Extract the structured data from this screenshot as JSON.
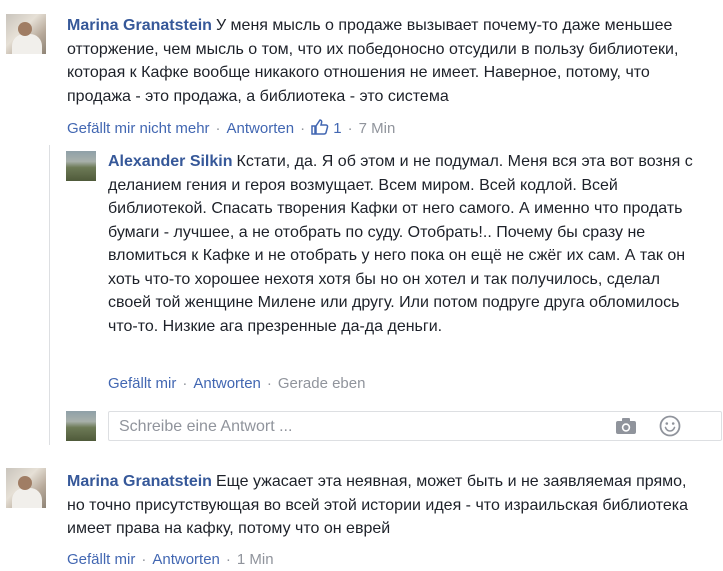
{
  "comments": [
    {
      "author": "Marina Granatstein",
      "text": "У меня мысль о продаже вызывает почему-то даже меньшее отторжение, чем мысль о том, что их победоносно отсудили в пользу библиотеки, которая к Кафке вообще никакого отношения не имеет. Наверное, потому, что продажа - это продажа, а библиотека - это система",
      "like_label": "Gefällt mir nicht mehr",
      "reply_label": "Antworten",
      "like_count": "1",
      "time": "7 Min"
    },
    {
      "author": "Alexander Silkin",
      "text": "Кстати, да. Я об этом и не подумал. Меня вся эта вот возня с деланием гения и героя возмущает. Всем миром. Всей кодлой. Всей библиотекой. Спасать творения Кафки от него самого. А именно что продать бумаги - лучшее, а не отобрать по суду. Отобрать!.. Почему бы сразу не вломиться к Кафке и не отобрать у него пока он ещё не сжёг их сам. А так он хоть что-то хорошее нехотя хотя бы но он хотел и так получилось, сделал своей той женщине Милене или другу. Или потом подруге друга обломилось что-то. Низкие ага презренные да-да деньги.",
      "like_label": "Gefällt mir",
      "reply_label": "Antworten",
      "time": "Gerade eben"
    },
    {
      "author": "Marina Granatstein",
      "text": "Еще ужасает эта неявная, может быть и не заявляемая прямо, но точно присутствующая во всей этой истории идея - что израильская библиотека имеет права на кафку, потому что он еврей",
      "like_label": "Gefällt mir",
      "reply_label": "Antworten",
      "time": "1 Min"
    }
  ],
  "reply_box": {
    "placeholder": "Schreibe eine Antwort ...",
    "camera_icon": "camera-icon",
    "emoji_icon": "smiley-icon"
  },
  "colors": {
    "author": "#365899",
    "link": "#4267b2",
    "meta": "#90949c",
    "text": "#1d2129"
  }
}
